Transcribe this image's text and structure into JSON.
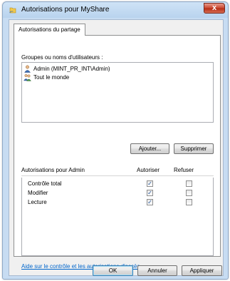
{
  "window": {
    "title": "Autorisations pour MyShare",
    "close_glyph": "x"
  },
  "tab": {
    "label": "Autorisations du partage"
  },
  "users": {
    "label": "Groupes ou noms d'utilisateurs :",
    "items": [
      {
        "name": "Admin (MINT_PR_INT\\Admin)",
        "icon": "user-icon"
      },
      {
        "name": "Tout le monde",
        "icon": "group-icon"
      }
    ],
    "add_button": "Ajouter...",
    "remove_button": "Supprimer"
  },
  "permissions": {
    "header": "Autorisations pour Admin",
    "allow_header": "Autoriser",
    "deny_header": "Refuser",
    "rows": [
      {
        "name": "Contrôle total",
        "allow": true,
        "deny": false
      },
      {
        "name": "Modifier",
        "allow": true,
        "deny": false
      },
      {
        "name": "Lecture",
        "allow": true,
        "deny": false
      }
    ]
  },
  "help_link": "Aide sur le contrôle et les autorisations d'accès",
  "footer": {
    "ok": "OK",
    "cancel": "Annuler",
    "apply": "Appliquer"
  }
}
